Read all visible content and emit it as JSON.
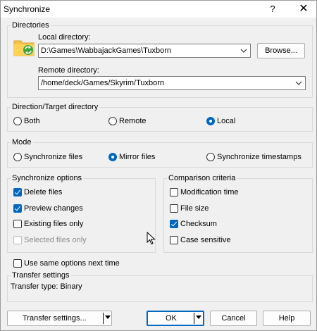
{
  "window": {
    "title": "Synchronize",
    "help_glyph": "?",
    "close_glyph": "✕"
  },
  "directories": {
    "group_label": "Directories",
    "local_label": "Local directory:",
    "local_value": "D:\\Games\\WabbajackGames\\Tuxborn",
    "browse_label": "Browse...",
    "remote_label": "Remote directory:",
    "remote_value": "/home/deck/Games/Skyrim/Tuxborn"
  },
  "direction": {
    "group_label": "Direction/Target directory",
    "options": [
      "Both",
      "Remote",
      "Local"
    ],
    "selected": "Local"
  },
  "mode": {
    "group_label": "Mode",
    "options": [
      "Synchronize files",
      "Mirror files",
      "Synchronize timestamps"
    ],
    "selected": "Mirror files"
  },
  "sync_options": {
    "group_label": "Synchronize options",
    "items": [
      {
        "label": "Delete files",
        "checked": true,
        "enabled": true
      },
      {
        "label": "Preview changes",
        "checked": true,
        "enabled": true
      },
      {
        "label": "Existing files only",
        "checked": false,
        "enabled": true
      },
      {
        "label": "Selected files only",
        "checked": false,
        "enabled": false
      }
    ]
  },
  "comparison": {
    "group_label": "Comparison criteria",
    "items": [
      {
        "label": "Modification time",
        "checked": false
      },
      {
        "label": "File size",
        "checked": false
      },
      {
        "label": "Checksum",
        "checked": true
      },
      {
        "label": "Case sensitive",
        "checked": false
      }
    ]
  },
  "same_options": {
    "label": "Use same options next time",
    "checked": false
  },
  "transfer": {
    "group_label": "Transfer settings",
    "type_text": "Transfer type: Binary"
  },
  "buttons": {
    "transfer_settings": "Transfer settings...",
    "ok": "OK",
    "cancel": "Cancel",
    "help": "Help"
  },
  "colors": {
    "accent": "#0067c0",
    "background": "#f0f0f0"
  }
}
